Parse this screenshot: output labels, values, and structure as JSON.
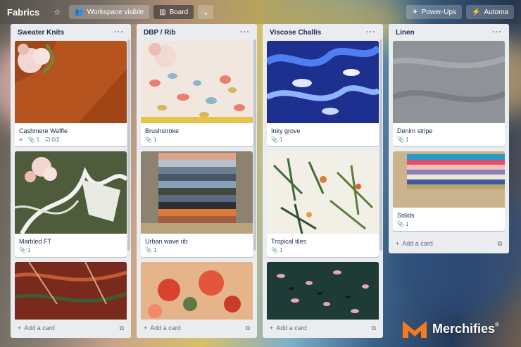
{
  "header": {
    "board_title": "Fabrics",
    "visibility_label": "Workspace visible",
    "view_label": "Board",
    "powerups_label": "Power-Ups",
    "automation_label": "Automa"
  },
  "lists": [
    {
      "title": "Sweater Knits",
      "cards": [
        {
          "title": "Cashmere Waffle",
          "attachments": "1",
          "checklist": "0/2",
          "has_description": true
        },
        {
          "title": "Marbled FT",
          "attachments": "1"
        },
        {
          "title": ""
        }
      ],
      "add_label": "Add a card"
    },
    {
      "title": "DBP / Rib",
      "cards": [
        {
          "title": "Brushstroke",
          "attachments": "1"
        },
        {
          "title": "Urban wave rib",
          "attachments": "1"
        },
        {
          "title": ""
        }
      ],
      "add_label": "Add a card"
    },
    {
      "title": "Viscose Challis",
      "cards": [
        {
          "title": "Inky grove",
          "attachments": "1"
        },
        {
          "title": "Tropical tiles",
          "attachments": "1"
        },
        {
          "title": ""
        }
      ],
      "add_label": "Add a card"
    },
    {
      "title": "Linen",
      "cards": [
        {
          "title": "Denim stripe",
          "attachments": "1"
        },
        {
          "title": "Solids",
          "attachments": "1"
        }
      ],
      "add_label": "Add a card"
    }
  ],
  "watermark": {
    "brand": "Merchifies",
    "mark": "®"
  }
}
